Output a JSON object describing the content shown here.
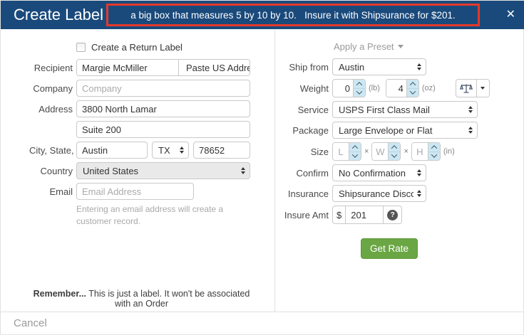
{
  "header": {
    "title": "Create Label",
    "annotation": "a big box that measures 5 by 10 by 10.   Insure it with Shipsurance for $201.",
    "close_glyph": "✕"
  },
  "left": {
    "return_label": {
      "label": "Create a Return Label",
      "checked": false
    },
    "recipient": {
      "label": "Recipient",
      "value": "Margie McMiller",
      "paste_button": "Paste US Address"
    },
    "company": {
      "label": "Company",
      "placeholder": "Company"
    },
    "address": {
      "label": "Address",
      "line1": "3800 North Lamar",
      "line2": "Suite 200"
    },
    "city_state_zip": {
      "label": "City, State, Zip",
      "city": "Austin",
      "state": "TX",
      "zip": "78652"
    },
    "country": {
      "label": "Country",
      "value": "United States"
    },
    "email": {
      "label": "Email",
      "placeholder": "Email Address",
      "help": "Entering an email address will create a customer record."
    },
    "reminder_bold": "Remember...",
    "reminder_text": " This is just a label. It won't be associated with an Order"
  },
  "right": {
    "preset_label": "Apply a Preset",
    "ship_from": {
      "label": "Ship from",
      "value": "Austin"
    },
    "weight": {
      "label": "Weight",
      "lb_value": "0",
      "lb_unit": "(lb)",
      "oz_value": "4",
      "oz_unit": "(oz)"
    },
    "service": {
      "label": "Service",
      "value": "USPS First Class Mail"
    },
    "package": {
      "label": "Package",
      "value": "Large Envelope or Flat"
    },
    "size": {
      "label": "Size",
      "l_placeholder": "L",
      "w_placeholder": "W",
      "h_placeholder": "H",
      "times": "×",
      "unit": "(in)"
    },
    "confirm": {
      "label": "Confirm",
      "value": "No Confirmation"
    },
    "insurance": {
      "label": "Insurance",
      "value": "Shipsurance Discount Ins"
    },
    "insure_amt": {
      "label": "Insure Amt",
      "currency": "$",
      "value": "201",
      "help_glyph": "?"
    },
    "get_rate_button": "Get Rate"
  },
  "footer": {
    "cancel": "Cancel"
  },
  "colors": {
    "header_bg": "#1a4a7c",
    "annotation_border": "#e5392b",
    "get_rate_green": "#6aa644",
    "spinner_blue": "#cde7f2",
    "country_select_bg": "#e9e9e9"
  }
}
